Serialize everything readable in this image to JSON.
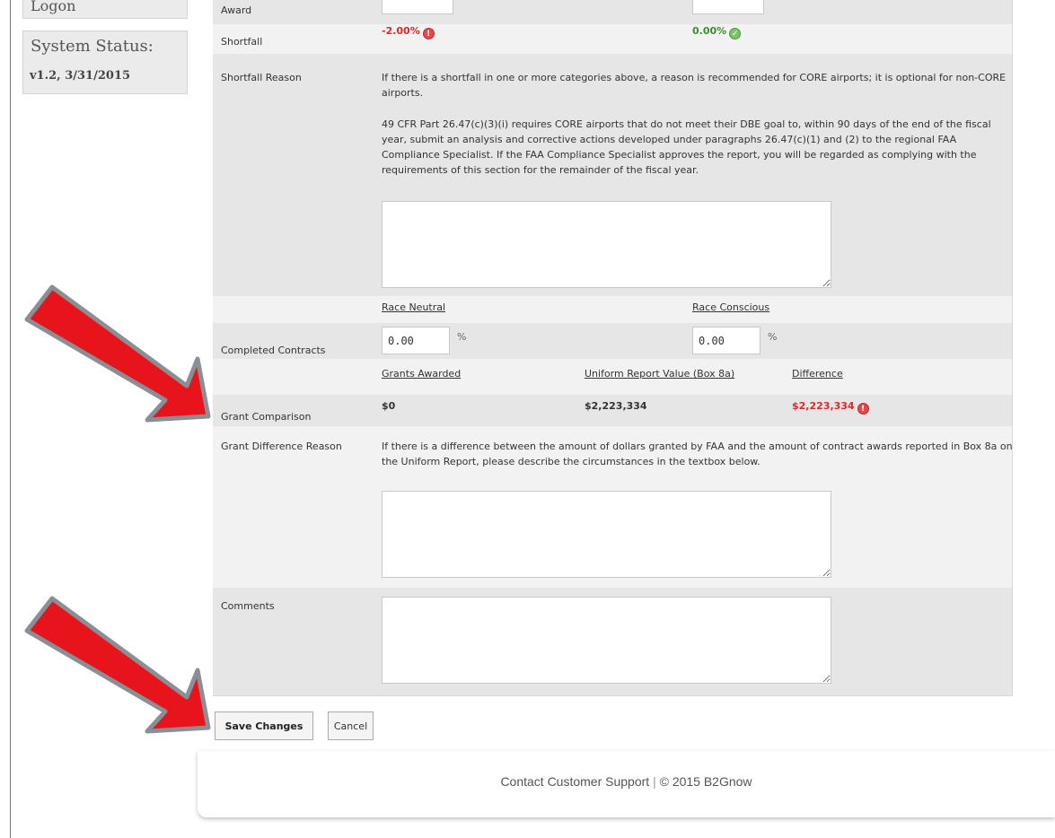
{
  "sidebar": {
    "logon_label": "Logon",
    "status_title": "System Status:",
    "status_version": "v1.2, 3/31/2015"
  },
  "form": {
    "award_label": "Award",
    "shortfall": {
      "label": "Shortfall",
      "race_neutral_value": "-2.00%",
      "race_conscious_value": "0.00%"
    },
    "shortfall_reason": {
      "label": "Shortfall Reason",
      "para1": "If there is a shortfall in one or more categories above, a reason is recommended for CORE airports; it is optional for non-CORE airports.",
      "para2": "49 CFR Part 26.47(c)(3)(i) requires CORE airports that do not meet their DBE goal to, within 90 days of the end of the fiscal year, submit an analysis and corrective actions developed under paragraphs 26.47(c)(1) and (2) to the regional FAA Compliance Specialist. If the FAA Compliance Specialist approves the report, you will be regarded as complying with the requirements of this section for the remainder of the fiscal year.",
      "value": ""
    },
    "columns": {
      "race_neutral": "Race Neutral",
      "race_conscious": "Race Conscious"
    },
    "completed_contracts": {
      "label": "Completed Contracts",
      "race_neutral_value": "0.00",
      "race_conscious_value": "0.00",
      "unit": "%"
    },
    "grant_comparison": {
      "label": "Grant Comparison",
      "col_grants_awarded": "Grants Awarded",
      "col_uniform_report": "Uniform Report Value (Box 8a)",
      "col_difference": "Difference",
      "grants_awarded": "$0",
      "uniform_report_value": "$2,223,334",
      "difference": "$2,223,334"
    },
    "grant_difference_reason": {
      "label": "Grant Difference Reason",
      "instructions": "If there is a difference between the amount of dollars granted by FAA and the amount of contract awards reported in Box 8a on the Uniform Report, please describe the circumstances in the textbox below.",
      "value": ""
    },
    "comments": {
      "label": "Comments",
      "value": ""
    }
  },
  "buttons": {
    "save": "Save Changes",
    "cancel": "Cancel"
  },
  "footer": {
    "support_link": "Contact Customer Support",
    "separator": "|",
    "copyright": "© 2015 B2Gnow"
  },
  "colors": {
    "arrow": "#e8141b",
    "arrow_outline": "#8a8f95",
    "error_red": "#e0262b",
    "ok_green": "#3a8f2e"
  },
  "icons": {
    "error": "error-circle-icon",
    "ok": "check-circle-icon"
  }
}
